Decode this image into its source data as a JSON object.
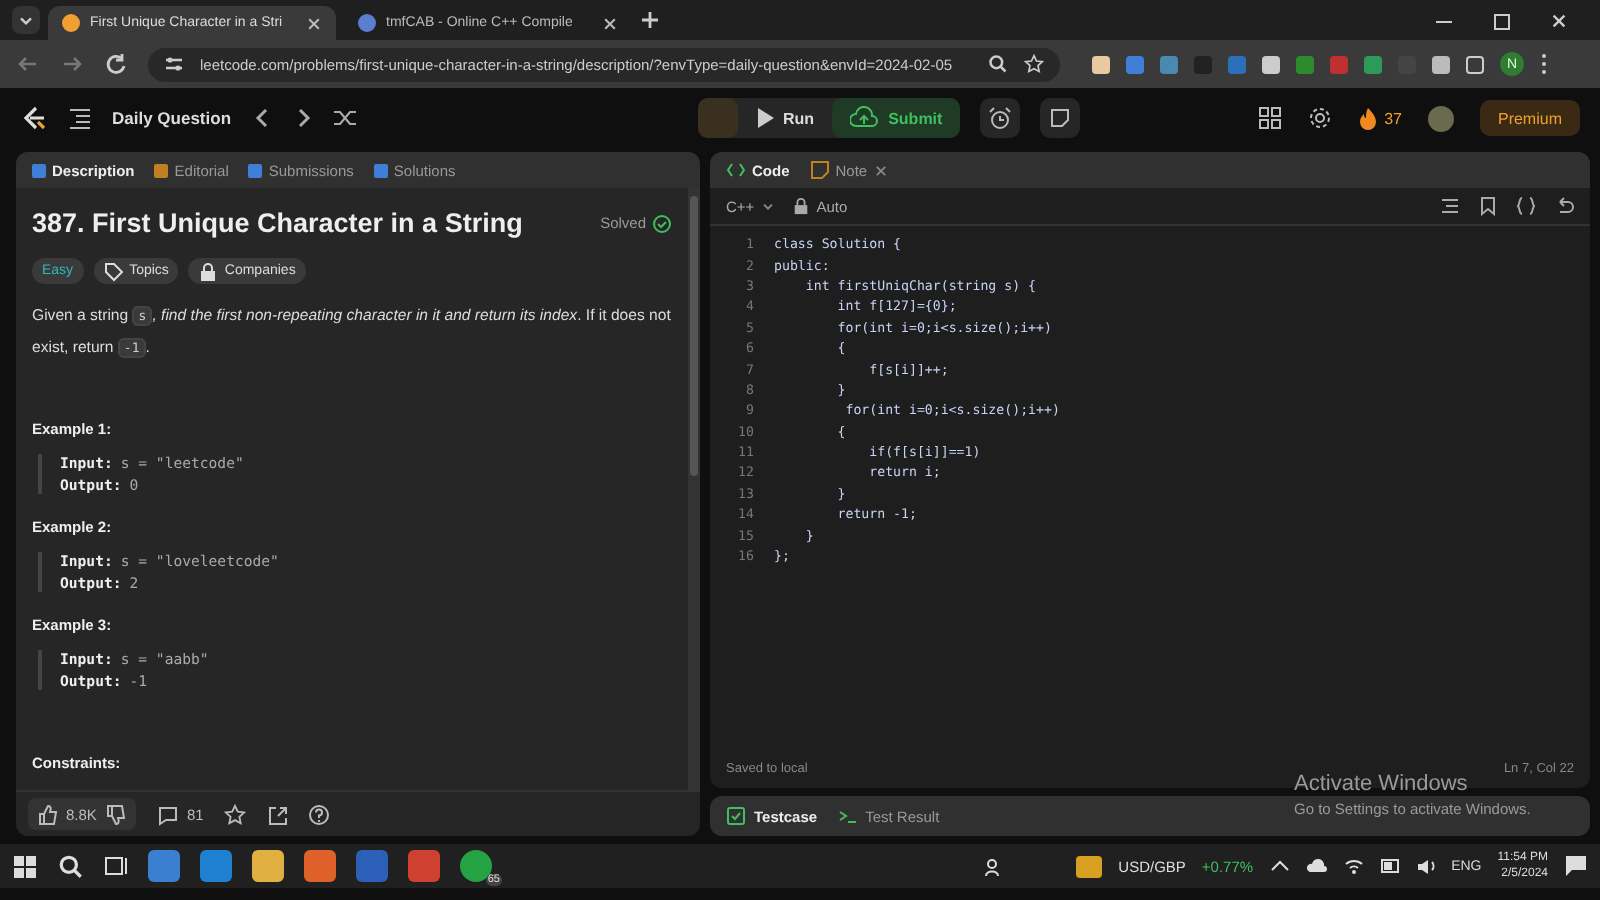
{
  "browser": {
    "tabs": [
      {
        "title": "First Unique Character in a Stri",
        "selected": true
      },
      {
        "title": "tmfCAB - Online C++ Compile",
        "selected": false
      }
    ],
    "url": "leetcode.com/problems/first-unique-character-in-a-string/description/?envType=daily-question&envId=2024-02-05",
    "profile": "N"
  },
  "header": {
    "daily": "Daily Question",
    "run": "Run",
    "submit": "Submit",
    "streak": "37",
    "premium": "Premium"
  },
  "left_panel": {
    "tabs": [
      {
        "label": "Description",
        "selected": true
      },
      {
        "label": "Editorial",
        "selected": false
      },
      {
        "label": "Submissions",
        "selected": false
      },
      {
        "label": "Solutions",
        "selected": false
      }
    ],
    "title": "387. First Unique Character in a String",
    "status": "Solved",
    "tags": [
      {
        "kind": "difficulty",
        "label": "Easy"
      },
      {
        "kind": "topics",
        "label": "Topics"
      },
      {
        "kind": "companies",
        "label": "Companies"
      }
    ],
    "description": [
      {
        "kind": "text",
        "text": "Given a string "
      },
      {
        "kind": "code",
        "text": "s"
      },
      {
        "kind": "italic",
        "text": ", find the first non-repeating character in it and return its index"
      },
      {
        "kind": "text",
        "text": ". If it does not exist, return "
      },
      {
        "kind": "code",
        "text": "-1"
      },
      {
        "kind": "text",
        "text": "."
      }
    ],
    "examples": [
      {
        "title": "Example 1:",
        "input_label": "Input:",
        "input": "s = \"leetcode\"",
        "output_label": "Output:",
        "output": "0"
      },
      {
        "title": "Example 2:",
        "input_label": "Input:",
        "input": "s = \"loveleetcode\"",
        "output_label": "Output:",
        "output": "2"
      },
      {
        "title": "Example 3:",
        "input_label": "Input:",
        "input": "s = \"aabb\"",
        "output_label": "Output:",
        "output": "-1"
      }
    ],
    "constraints_title": "Constraints:",
    "likes": "8.8K",
    "comments": "81"
  },
  "code_panel": {
    "tabs": [
      {
        "label": "Code",
        "selected": true
      },
      {
        "label": "Note",
        "selected": false
      }
    ],
    "language": "C++",
    "mode": "Auto",
    "lines": [
      {
        "number": "1",
        "text": "class Solution {"
      },
      {
        "number": "2",
        "text": "public:"
      },
      {
        "number": "3",
        "text": "    int firstUniqChar(string s) {"
      },
      {
        "number": "4",
        "text": "        int f[127]={0};"
      },
      {
        "number": "5",
        "text": "        for(int i=0;i<s.size();i++)"
      },
      {
        "number": "6",
        "text": "        {"
      },
      {
        "number": "7",
        "text": "            f[s[i]]++;"
      },
      {
        "number": "8",
        "text": "        }"
      },
      {
        "number": "9",
        "text": "         for(int i=0;i<s.size();i++)"
      },
      {
        "number": "10",
        "text": "        {"
      },
      {
        "number": "11",
        "text": "            if(f[s[i]]==1)"
      },
      {
        "number": "12",
        "text": "            return i;"
      },
      {
        "number": "13",
        "text": "        }"
      },
      {
        "number": "14",
        "text": "        return -1;"
      },
      {
        "number": "15",
        "text": "    }"
      },
      {
        "number": "16",
        "text": "};"
      }
    ],
    "save_status": "Saved to local",
    "cursor": "Ln 7, Col 22"
  },
  "bottom_panel": {
    "tabs": [
      {
        "label": "Testcase",
        "selected": true
      },
      {
        "label": "Test Result",
        "selected": false
      }
    ]
  },
  "activation": {
    "title": "Activate Windows",
    "hint": "Go to Settings to activate Windows."
  },
  "taskbar": {
    "whatsapp_badge": "65",
    "ticker": "USD/GBP",
    "change": "+0.77%",
    "language": "ENG",
    "time": "11:54 PM",
    "date": "2/5/2024"
  }
}
